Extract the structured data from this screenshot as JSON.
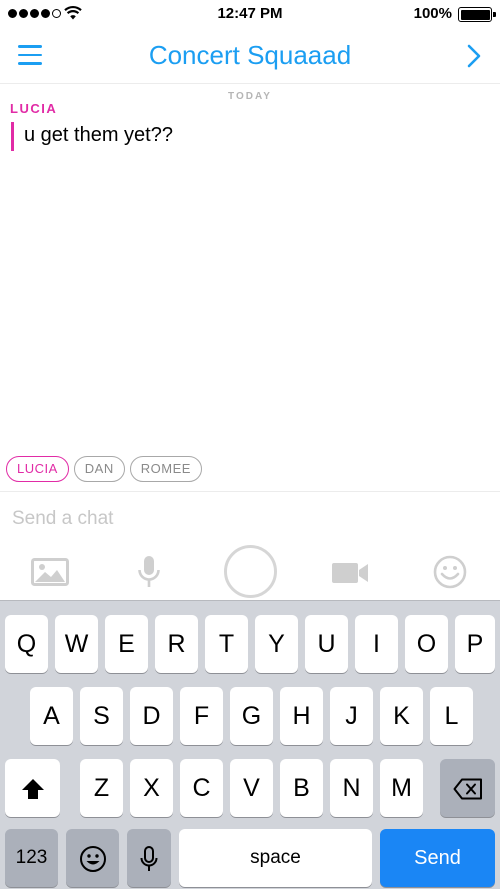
{
  "status_bar": {
    "time": "12:47 PM",
    "battery": "100%",
    "signal_dots_filled": 4,
    "signal_dots_total": 5
  },
  "header": {
    "title": "Concert Squaaad",
    "menu_icon": "hamburger-menu-icon",
    "forward_icon": "chevron-right-icon"
  },
  "chat": {
    "date_label": "TODAY",
    "messages": [
      {
        "sender": "LUCIA",
        "text": "u get them yet??"
      }
    ]
  },
  "participants": [
    {
      "name": "LUCIA",
      "active": true
    },
    {
      "name": "DAN",
      "active": false
    },
    {
      "name": "ROMEE",
      "active": false
    }
  ],
  "compose": {
    "placeholder": "Send a chat",
    "value": ""
  },
  "tools": [
    "image-icon",
    "microphone-icon",
    "capture-button",
    "video-camera-icon",
    "smiley-icon"
  ],
  "keyboard": {
    "row1": [
      "Q",
      "W",
      "E",
      "R",
      "T",
      "Y",
      "U",
      "I",
      "O",
      "P"
    ],
    "row2": [
      "A",
      "S",
      "D",
      "F",
      "G",
      "H",
      "J",
      "K",
      "L"
    ],
    "row3": [
      "Z",
      "X",
      "C",
      "V",
      "B",
      "N",
      "M"
    ],
    "numbers_label": "123",
    "space_label": "space",
    "send_label": "Send"
  },
  "colors": {
    "accent_blue": "#1b9ef2",
    "sender_pink": "#e12ba6",
    "send_key_blue": "#1a86f5",
    "keyboard_bg": "#d1d4da"
  }
}
